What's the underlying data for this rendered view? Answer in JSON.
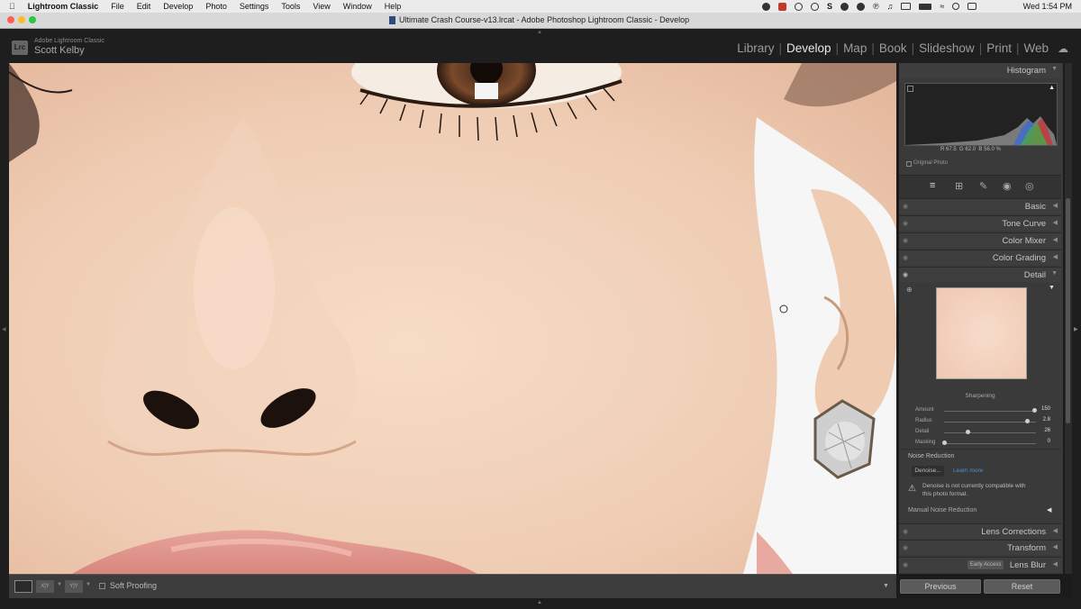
{
  "menubar": {
    "app": "Lightroom Classic",
    "items": [
      "File",
      "Edit",
      "Develop",
      "Photo",
      "Settings",
      "Tools",
      "View",
      "Window",
      "Help"
    ],
    "clock": "Wed 1:54 PM"
  },
  "window": {
    "title": "Ultimate Crash Course-v13.lrcat - Adobe Photoshop Lightroom Classic - Develop"
  },
  "identity": {
    "logo": "Lrc",
    "product": "Adobe Lightroom Classic",
    "user": "Scott Kelby"
  },
  "modules": [
    {
      "label": "Library",
      "active": false
    },
    {
      "label": "Develop",
      "active": true
    },
    {
      "label": "Map",
      "active": false
    },
    {
      "label": "Book",
      "active": false
    },
    {
      "label": "Slideshow",
      "active": false
    },
    {
      "label": "Print",
      "active": false
    },
    {
      "label": "Web",
      "active": false
    }
  ],
  "histogram": {
    "title": "Histogram",
    "r_label": "R",
    "r": "67.5",
    "g_label": "G",
    "g": "62.0",
    "b_label": "B",
    "b": "56.0 %",
    "original": "Original Photo"
  },
  "panels": {
    "basic": "Basic",
    "tone_curve": "Tone Curve",
    "color_mixer": "Color Mixer",
    "color_grading": "Color Grading",
    "detail": "Detail",
    "lens_corrections": "Lens Corrections",
    "transform": "Transform",
    "lens_blur": "Lens Blur",
    "early_access": "Early Access"
  },
  "sharpening": {
    "title": "Sharpening",
    "sliders": [
      {
        "label": "Amount",
        "value": "150",
        "fraction": 1.0
      },
      {
        "label": "Radius",
        "value": "2.8",
        "fraction": 0.92
      },
      {
        "label": "Detail",
        "value": "26",
        "fraction": 0.26
      },
      {
        "label": "Masking",
        "value": "0",
        "fraction": 0.0
      }
    ]
  },
  "noise": {
    "title": "Noise Reduction",
    "denoise": "Denoise...",
    "learn": "Learn more",
    "warning": "Denoise is not currently compatible with this photo format.",
    "manual": "Manual Noise Reduction"
  },
  "toolbar": {
    "soft_proofing": "Soft Proofing",
    "compare_xy": "X|Y",
    "compare_ry": "Y|Y"
  },
  "footer": {
    "previous": "Previous",
    "reset": "Reset"
  },
  "colors": {
    "panel": "#3a3a3a",
    "header": "#1e1e1e",
    "skin": "#efcfb8",
    "active_text": "#e8e8e8"
  }
}
